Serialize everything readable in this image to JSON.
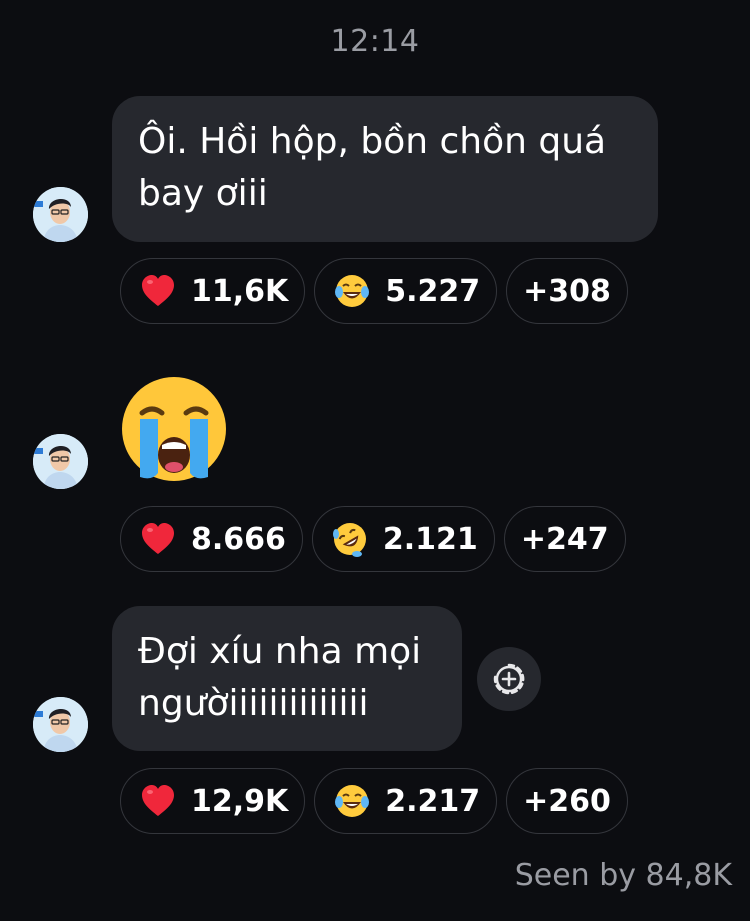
{
  "timestamp": "12:14",
  "messages": [
    {
      "type": "text",
      "text": "Ôi. Hồi hộp, bồn chồn quá\nbay ơiii",
      "reactions": [
        {
          "icon": "red-heart-icon",
          "count": "11,6K"
        },
        {
          "icon": "face-with-tears-of-joy-icon",
          "count": "5.227"
        }
      ],
      "more": "+308"
    },
    {
      "type": "emoji",
      "emoji_icon": "loudly-crying-face-icon",
      "reactions": [
        {
          "icon": "red-heart-icon",
          "count": "8.666"
        },
        {
          "icon": "rolling-on-floor-laughing-icon",
          "count": "2.121"
        }
      ],
      "more": "+247"
    },
    {
      "type": "text",
      "text": "Đợi xíu nha mọi\nngườiiiiiiiiiiiiii",
      "reactions": [
        {
          "icon": "red-heart-icon",
          "count": "12,9K"
        },
        {
          "icon": "face-with-tears-of-joy-icon",
          "count": "2.217"
        }
      ],
      "more": "+260"
    }
  ],
  "add_reaction_icon": "add-reaction-icon",
  "seen": "Seen by 84,8K",
  "colors": {
    "background": "#0c0d11",
    "bubble": "#26282e",
    "muted_text": "#9a9ca3",
    "chip_border": "#34363c"
  }
}
